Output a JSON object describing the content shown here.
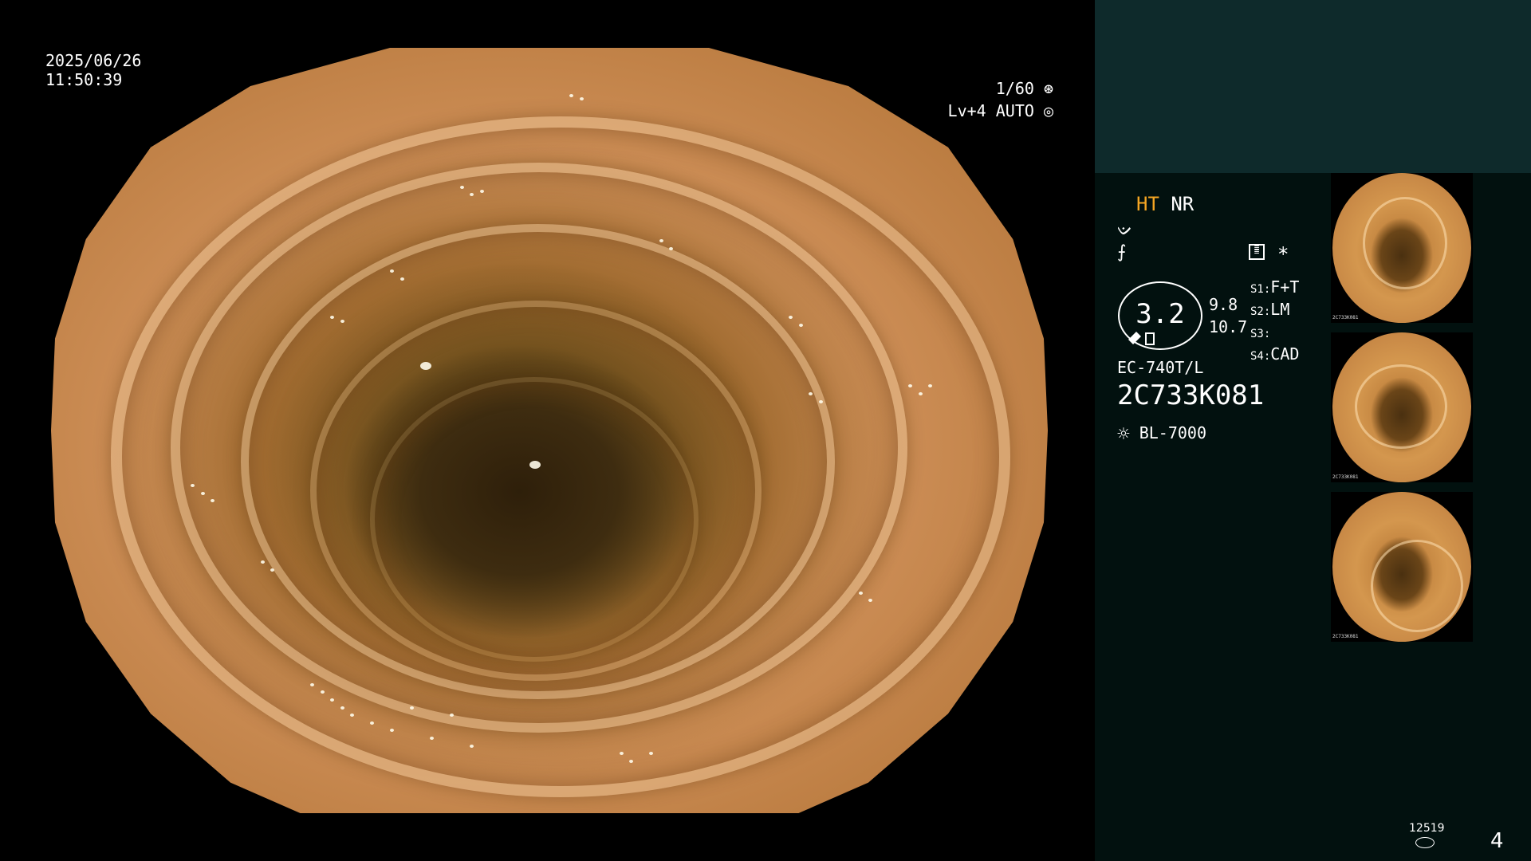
{
  "date": "2025/06/26",
  "time": "11:50:39",
  "shutter": "1/60",
  "shutter_icon": "aperture-icon",
  "iris_level": "Lv+4 AUTO",
  "iris_icon": "iris-icon",
  "panel": {
    "mode_ht": "HT",
    "mode_nr": "NR",
    "ht_color": "#f5a623",
    "icons": [
      "curve-icon",
      "no-filter-icon",
      "settings-list-icon",
      "asterisk-icon"
    ],
    "gauge_value": "3.2",
    "value_a": "9.8",
    "value_b": "10.7",
    "s1_key": "S1:",
    "s1_val": "F+T",
    "s2_key": "S2:",
    "s2_val": "LM",
    "s3_key": "S3:",
    "s3_val": "",
    "s4_key": "S4:",
    "s4_val": "CAD",
    "scope_model": "EC-740T/L",
    "serial": "2C733K081",
    "light_source": "BL-7000",
    "light_icon": "sun-icon"
  },
  "thumbnails": [
    {
      "name": "capture-1",
      "caption": "2C733K081"
    },
    {
      "name": "capture-2",
      "caption": "2C733K081"
    },
    {
      "name": "capture-3",
      "caption": "2C733K081"
    }
  ],
  "storage_count": "12519",
  "storage_icon": "disk-icon",
  "capture_count": "4"
}
